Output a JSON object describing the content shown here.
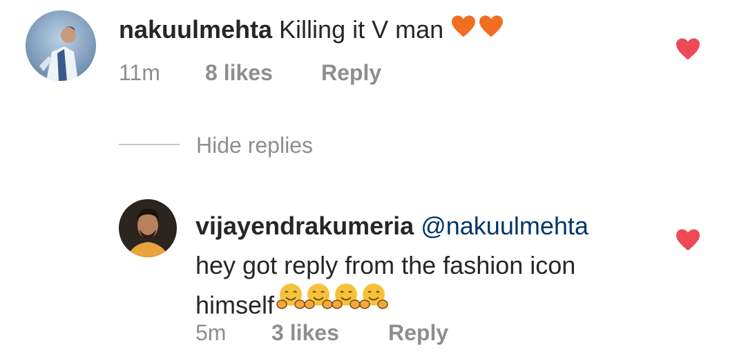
{
  "comments": [
    {
      "username": "nakuulmehta",
      "text": "Killing it V man",
      "time": "11m",
      "likes": "8 likes",
      "reply_label": "Reply"
    }
  ],
  "replies_toggle": {
    "label": "Hide replies"
  },
  "reply": {
    "username": "vijayendrakumeria",
    "mention": "@nakuulmehta",
    "text_line1": "hey got reply from the fashion icon",
    "text_line2": "himself",
    "time": "5m",
    "likes": "3 likes",
    "reply_label": "Reply"
  },
  "colors": {
    "heart_orange": "#f26d21",
    "like_red": "#ed4956",
    "mention_blue": "#003569",
    "meta_gray": "#8e8e8e"
  },
  "icons": {
    "inline_emoji": "orange-heart-icon",
    "like": "heart-icon",
    "reply_emoji": "hugging-face-emoji"
  }
}
